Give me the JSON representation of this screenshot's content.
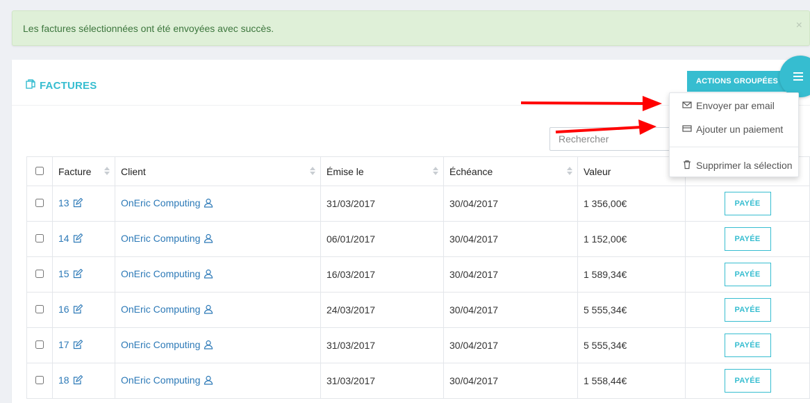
{
  "alert": {
    "message": "Les factures sélectionnées ont été envoyées avec succès.",
    "close_glyph": "×"
  },
  "panel": {
    "title": "FACTURES",
    "actions_button": "ACTIONS GROUPÉES"
  },
  "search": {
    "placeholder": "Rechercher",
    "value": ""
  },
  "dropdown": {
    "items": [
      {
        "label": "Envoyer par email",
        "icon": "envelope-icon"
      },
      {
        "label": "Ajouter un paiement",
        "icon": "credit-card-icon"
      },
      {
        "label": "Supprimer la sélection",
        "icon": "trash-icon"
      }
    ]
  },
  "table": {
    "headers": [
      "Facture",
      "Client",
      "Émise le",
      "Échéance",
      "Valeur"
    ],
    "rows": [
      {
        "number": "13",
        "client": "OnEric Computing",
        "issued": "31/03/2017",
        "due": "30/04/2017",
        "value": "1 356,00€",
        "status": "PAYÉE"
      },
      {
        "number": "14",
        "client": "OnEric Computing",
        "issued": "06/01/2017",
        "due": "30/04/2017",
        "value": "1 152,00€",
        "status": "PAYÉE"
      },
      {
        "number": "15",
        "client": "OnEric Computing",
        "issued": "16/03/2017",
        "due": "30/04/2017",
        "value": "1 589,34€",
        "status": "PAYÉE"
      },
      {
        "number": "16",
        "client": "OnEric Computing",
        "issued": "24/03/2017",
        "due": "30/04/2017",
        "value": "5 555,34€",
        "status": "PAYÉE"
      },
      {
        "number": "17",
        "client": "OnEric Computing",
        "issued": "31/03/2017",
        "due": "30/04/2017",
        "value": "5 555,34€",
        "status": "PAYÉE"
      },
      {
        "number": "18",
        "client": "OnEric Computing",
        "issued": "31/03/2017",
        "due": "30/04/2017",
        "value": "1 558,44€",
        "status": "PAYÉE"
      }
    ]
  },
  "colors": {
    "accent": "#36bdd0",
    "link": "#2c79b7",
    "alert_bg": "#dff0d8",
    "alert_text": "#3c763d",
    "annotation_arrow": "#ff0000"
  }
}
